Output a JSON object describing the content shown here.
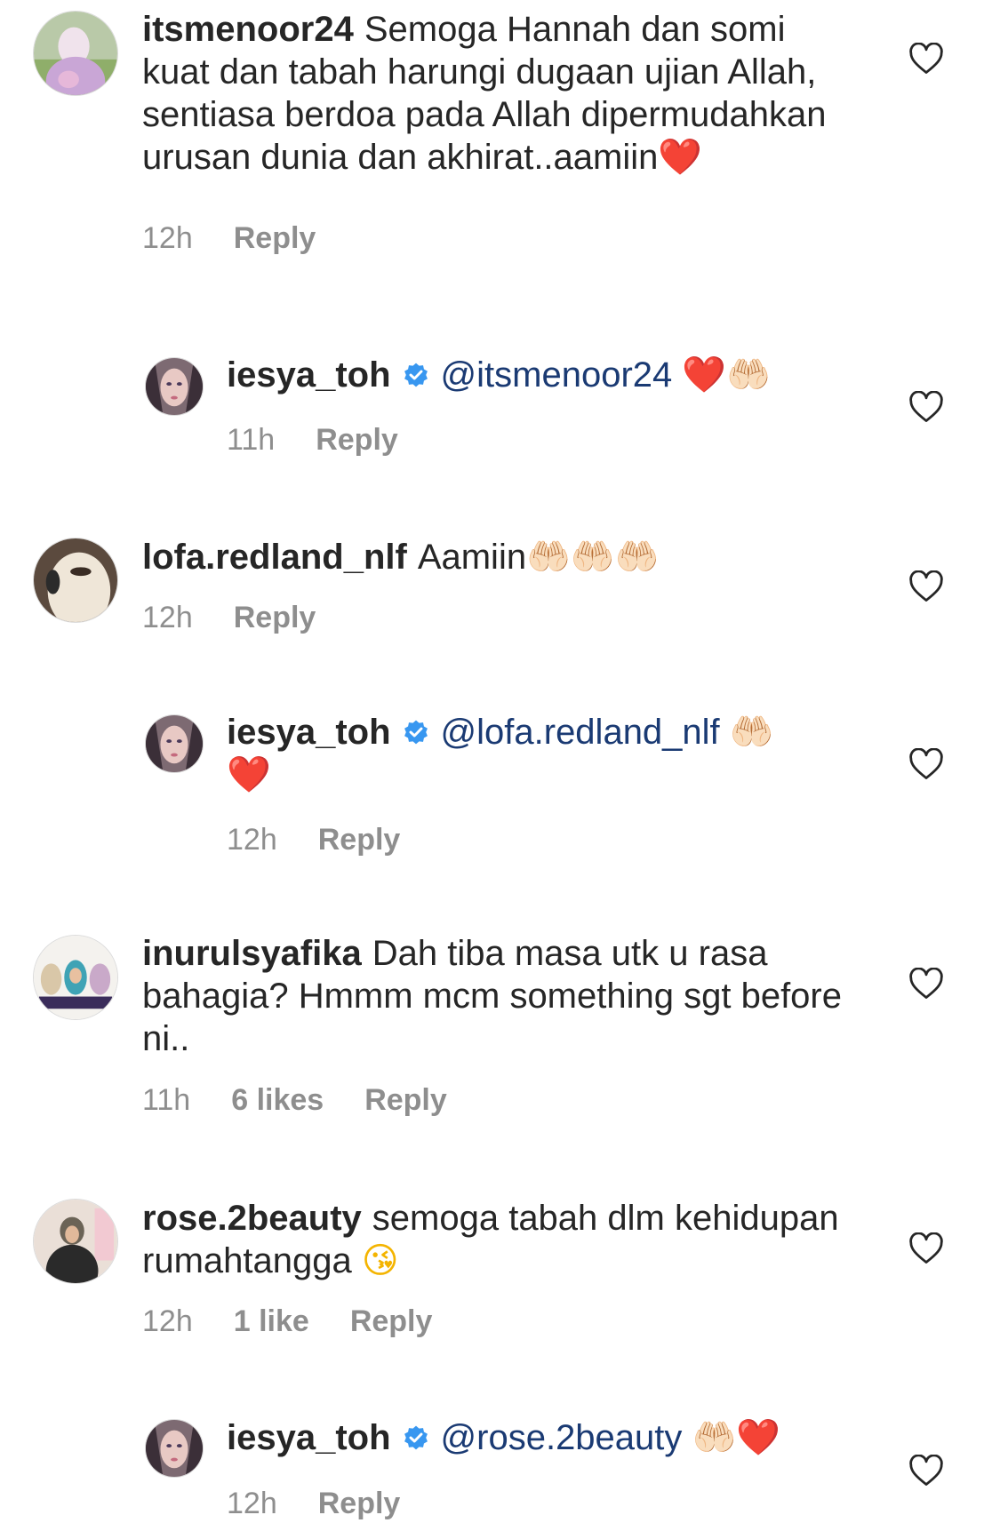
{
  "colors": {
    "text": "#262626",
    "meta": "#8e8e8e",
    "mention": "#1a3a73",
    "verified": "#3897f0"
  },
  "comments": [
    {
      "username": "itsmenoor24",
      "text": "Semoga Hannah dan somi kuat dan tabah harungi dugaan ujian Allah, sentiasa berdoa pada Allah dipermudahkan urusan dunia dan akhirat..aamiin",
      "emoji": "❤️",
      "time": "12h",
      "reply_label": "Reply"
    },
    {
      "username": "iesya_toh",
      "verified": true,
      "mention": "@itsmenoor24",
      "emoji": "❤️🤲🏻",
      "time": "11h",
      "reply_label": "Reply"
    },
    {
      "username": "lofa.redland_nlf",
      "text": "Aamiin",
      "emoji": "🤲🏻🤲🏻🤲🏻",
      "time": "12h",
      "reply_label": "Reply"
    },
    {
      "username": "iesya_toh",
      "verified": true,
      "mention": "@lofa.redland_nlf",
      "emoji": "🤲🏻",
      "emoji_2": "❤️",
      "time": "12h",
      "reply_label": "Reply"
    },
    {
      "username": "inurulsyafika",
      "text": "Dah tiba masa utk u rasa bahagia? Hmmm mcm something sgt before ni..",
      "time": "11h",
      "likes": "6 likes",
      "reply_label": "Reply"
    },
    {
      "username": "rose.2beauty",
      "text": "semoga tabah dlm kehidupan rumahtangga",
      "emoji": "😘",
      "time": "12h",
      "likes": "1 like",
      "reply_label": "Reply"
    },
    {
      "username": "iesya_toh",
      "verified": true,
      "mention": "@rose.2beauty",
      "emoji": "🤲🏻❤️",
      "time": "12h",
      "reply_label": "Reply"
    }
  ]
}
